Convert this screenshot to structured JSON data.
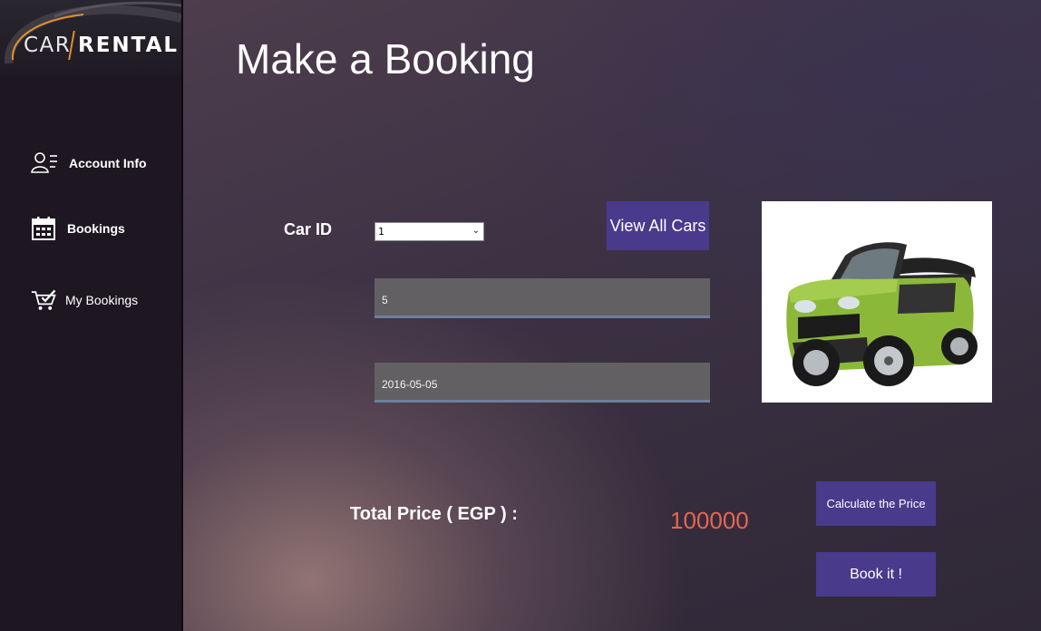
{
  "sidebar": {
    "logo": {
      "car": "CAR",
      "rental": "RENTAL"
    },
    "items": [
      {
        "label": "Account Info",
        "icon": "user-list-icon"
      },
      {
        "label": "Bookings",
        "icon": "calendar-icon"
      },
      {
        "label": "My Bookings",
        "icon": "cart-check-icon"
      }
    ]
  },
  "main": {
    "title": "Make a Booking",
    "car_id": {
      "label": "Car ID",
      "selected": "1"
    },
    "view_all_button": "View All Cars",
    "days_field": {
      "value": "5"
    },
    "date_field": {
      "value": "2016-05-05"
    },
    "car_image": {
      "description": "green-compact-car"
    },
    "total": {
      "label": "Total Price ( EGP ) :",
      "value": "100000"
    },
    "calculate_button": "Calculate the Price",
    "book_button": "Book it !"
  },
  "colors": {
    "accent_button": "#4a3a8c",
    "price": "#e86552",
    "sidebar": "#1e1721",
    "logo_accent": "#e0902a"
  }
}
